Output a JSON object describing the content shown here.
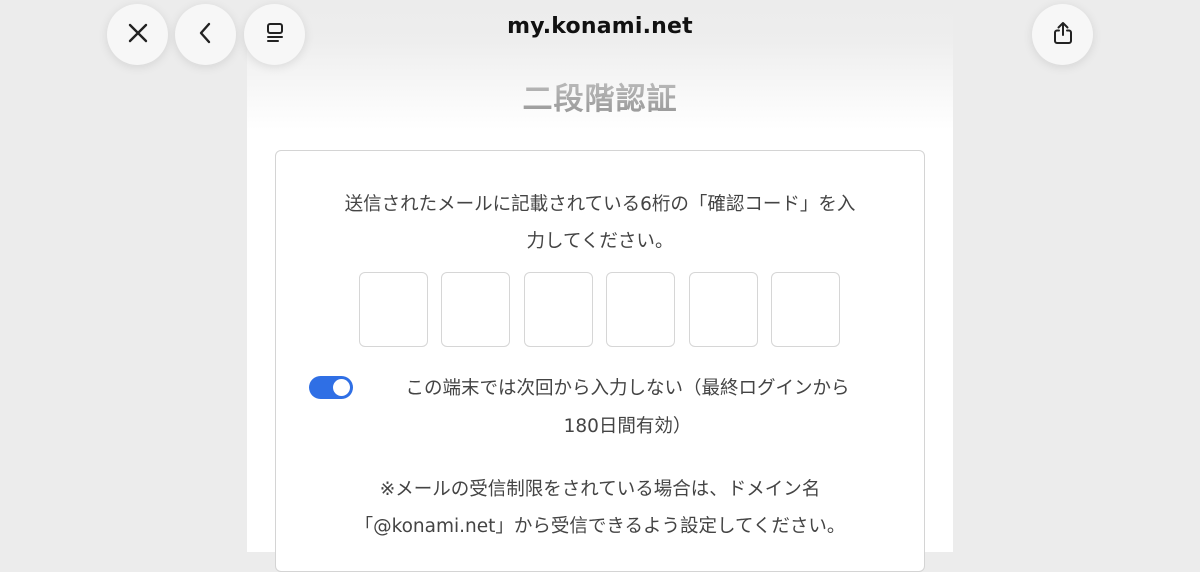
{
  "browser": {
    "url": "my.konami.net",
    "icons": {
      "close": "close-icon",
      "back": "chevron-left-icon",
      "tabs": "tab-overview-icon",
      "share": "share-icon"
    }
  },
  "page": {
    "title": "二段階認証",
    "instruction_line1": "送信されたメールに記載されている6桁の「確認コード」を入",
    "instruction_line2": "力してください。",
    "code_digits": [
      "",
      "",
      "",
      "",
      "",
      ""
    ],
    "remember_toggle": {
      "on": true,
      "label_line1": "この端末では次回から入力しない（最終ログインから",
      "label_line2": "180日間有効）"
    },
    "note_line1": "※メールの受信制限をされている場合は、ドメイン名",
    "note_line2": "「@konami.net」から受信できるよう設定してください。"
  },
  "colors": {
    "accent": "#2f6fe5",
    "title": "#8a8a8a",
    "background": "#ececec"
  }
}
